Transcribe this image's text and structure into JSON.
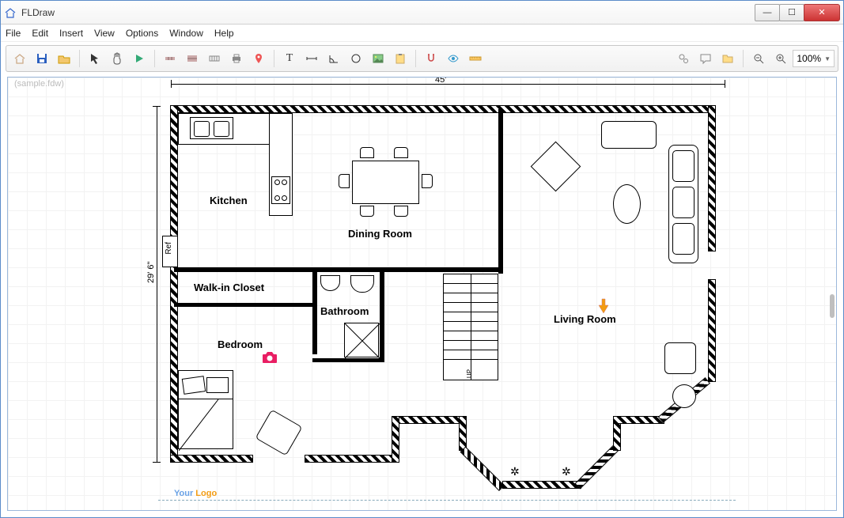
{
  "window": {
    "title": "FLDraw"
  },
  "menu": [
    "File",
    "Edit",
    "Insert",
    "View",
    "Options",
    "Window",
    "Help"
  ],
  "document": {
    "tab": "(sample.fdw)"
  },
  "toolbar": {
    "groups": [
      [
        "home",
        "save",
        "open-folder"
      ],
      [
        "pointer",
        "hand",
        "play"
      ],
      [
        "wall-1",
        "wall-2",
        "wall-3",
        "wall-4",
        "pin"
      ],
      [
        "text",
        "dimension",
        "angle",
        "circle",
        "image",
        "clipboard"
      ],
      [
        "magnet",
        "eye",
        "ruler"
      ]
    ],
    "right": [
      "gears",
      "comment",
      "folder"
    ],
    "zoom": {
      "out": "zoom-out",
      "in": "zoom-in",
      "value": "100%"
    }
  },
  "plan": {
    "dimensions": {
      "width": "45'",
      "height": "29' 6\""
    },
    "rooms": {
      "kitchen": "Kitchen",
      "dining": "Dining Room",
      "living": "Living Room",
      "walkin": "Walk-in Closet",
      "bathroom": "Bathroom",
      "bedroom": "Bedroom"
    },
    "appliances": {
      "ref": "Ref",
      "stairs_up": "UP"
    },
    "logo": {
      "your": "Your ",
      "logo": "Logo"
    }
  }
}
